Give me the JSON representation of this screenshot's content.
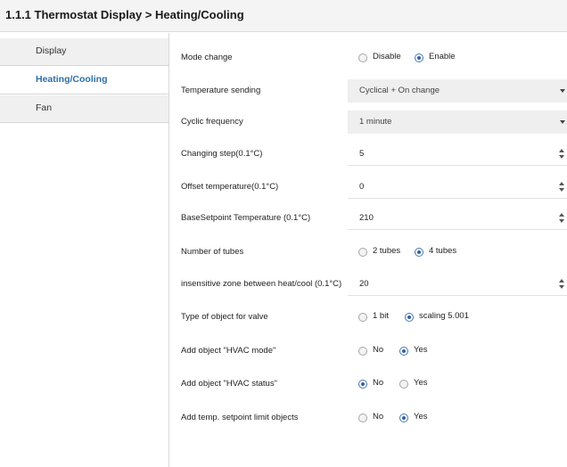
{
  "header": {
    "title": "1.1.1 Thermostat Display > Heating/Cooling"
  },
  "sidebar": {
    "items": [
      {
        "label": "Display",
        "active": false
      },
      {
        "label": "Heating/Cooling",
        "active": true
      },
      {
        "label": "Fan",
        "active": false
      }
    ]
  },
  "params": {
    "mode_change": {
      "label": "Mode change",
      "options": [
        "Disable",
        "Enable"
      ],
      "selected": "Enable"
    },
    "temperature_sending": {
      "label": "Temperature sending",
      "value": "Cyclical + On change"
    },
    "cyclic_frequency": {
      "label": "Cyclic frequency",
      "value": "1 minute"
    },
    "changing_step": {
      "label": "Changing step(0.1°C)",
      "value": "5"
    },
    "offset_temperature": {
      "label": "Offset temperature(0.1°C)",
      "value": "0"
    },
    "base_setpoint": {
      "label": "BaseSetpoint Temperature (0.1°C)",
      "value": "210"
    },
    "number_of_tubes": {
      "label": "Number of tubes",
      "options": [
        "2 tubes",
        "4 tubes"
      ],
      "selected": "4 tubes"
    },
    "insensitive_zone": {
      "label": "insensitive zone between heat/cool (0.1°C)",
      "value": "20"
    },
    "valve_object_type": {
      "label": "Type of object for valve",
      "options": [
        "1 bit",
        "scaling 5.001"
      ],
      "selected": "scaling 5.001"
    },
    "hvac_mode_object": {
      "label": "Add object \"HVAC mode\"",
      "options": [
        "No",
        "Yes"
      ],
      "selected": "Yes"
    },
    "hvac_status_object": {
      "label": "Add object \"HVAC status\"",
      "options": [
        "No",
        "Yes"
      ],
      "selected": "No"
    },
    "setpoint_limit_objects": {
      "label": "Add temp. setpoint limit objects",
      "options": [
        "No",
        "Yes"
      ],
      "selected": "Yes"
    }
  },
  "colors": {
    "accent": "#2e6ea6",
    "radio_selected": "#2f63a8",
    "select_bg": "#efefef",
    "sidebar_bg": "#f0f0f0"
  }
}
